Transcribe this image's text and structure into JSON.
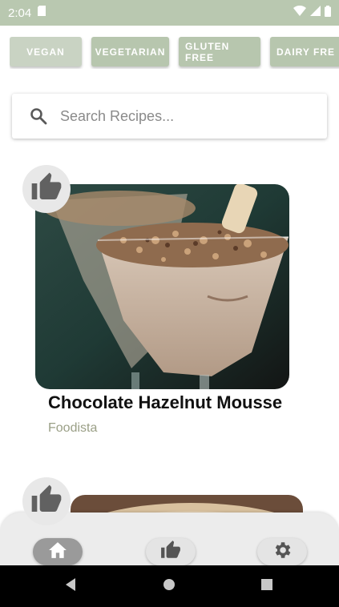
{
  "status_bar": {
    "time": "2:04"
  },
  "filters": {
    "chips": [
      {
        "label": "VEGAN",
        "active": true
      },
      {
        "label": "VEGETARIAN",
        "active": false
      },
      {
        "label": "GLUTEN FREE",
        "active": false
      },
      {
        "label": "DAIRY FRE",
        "active": false
      }
    ]
  },
  "search": {
    "placeholder": "Search Recipes..."
  },
  "recipes": [
    {
      "title": "Chocolate Hazelnut Mousse",
      "source": "Foodista"
    },
    {
      "title": "",
      "source": ""
    }
  ],
  "bottom_nav": {
    "items": [
      {
        "name": "home",
        "icon": "home-icon",
        "active": true
      },
      {
        "name": "favorites",
        "icon": "thumbs-up-icon",
        "active": false
      },
      {
        "name": "settings",
        "icon": "gear-icon",
        "active": false
      }
    ]
  },
  "colors": {
    "accent": "#b7c6ae",
    "status_bar": "#b9c8b0",
    "source_text": "#9a9f86"
  }
}
